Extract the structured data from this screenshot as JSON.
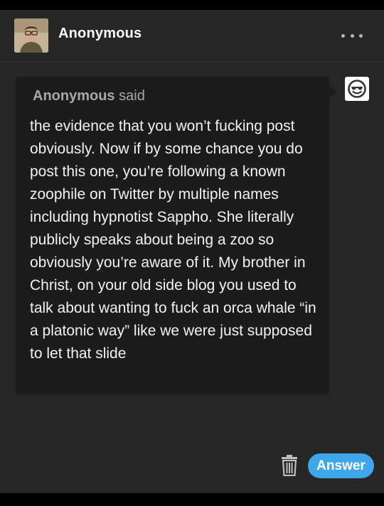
{
  "post": {
    "username": "Anonymous",
    "avatar_icon": "person-portrait-icon",
    "more_icon": "more-options-icon"
  },
  "ask": {
    "asker_name": "Anonymous",
    "said_label": "said",
    "asker_avatar_icon": "sunglasses-smiley-icon",
    "text": "the evidence that you won’t fucking post obviously. Now if by some chance you do post this one, you’re following a known zoophile on Twitter by multiple names including hypnotist Sappho. She literally publicly speaks about being a zoo so obviously you’re aware of it. My brother in Christ, on your old side blog you used to talk about wanting to fuck an orca whale “in a platonic way” like we were just supposed to let that slide"
  },
  "actions": {
    "delete_icon": "trash-icon",
    "answer_label": "Answer"
  },
  "colors": {
    "background": "#000000",
    "card": "#262626",
    "bubble": "#1c1c1c",
    "accent": "#3ea7ea"
  }
}
